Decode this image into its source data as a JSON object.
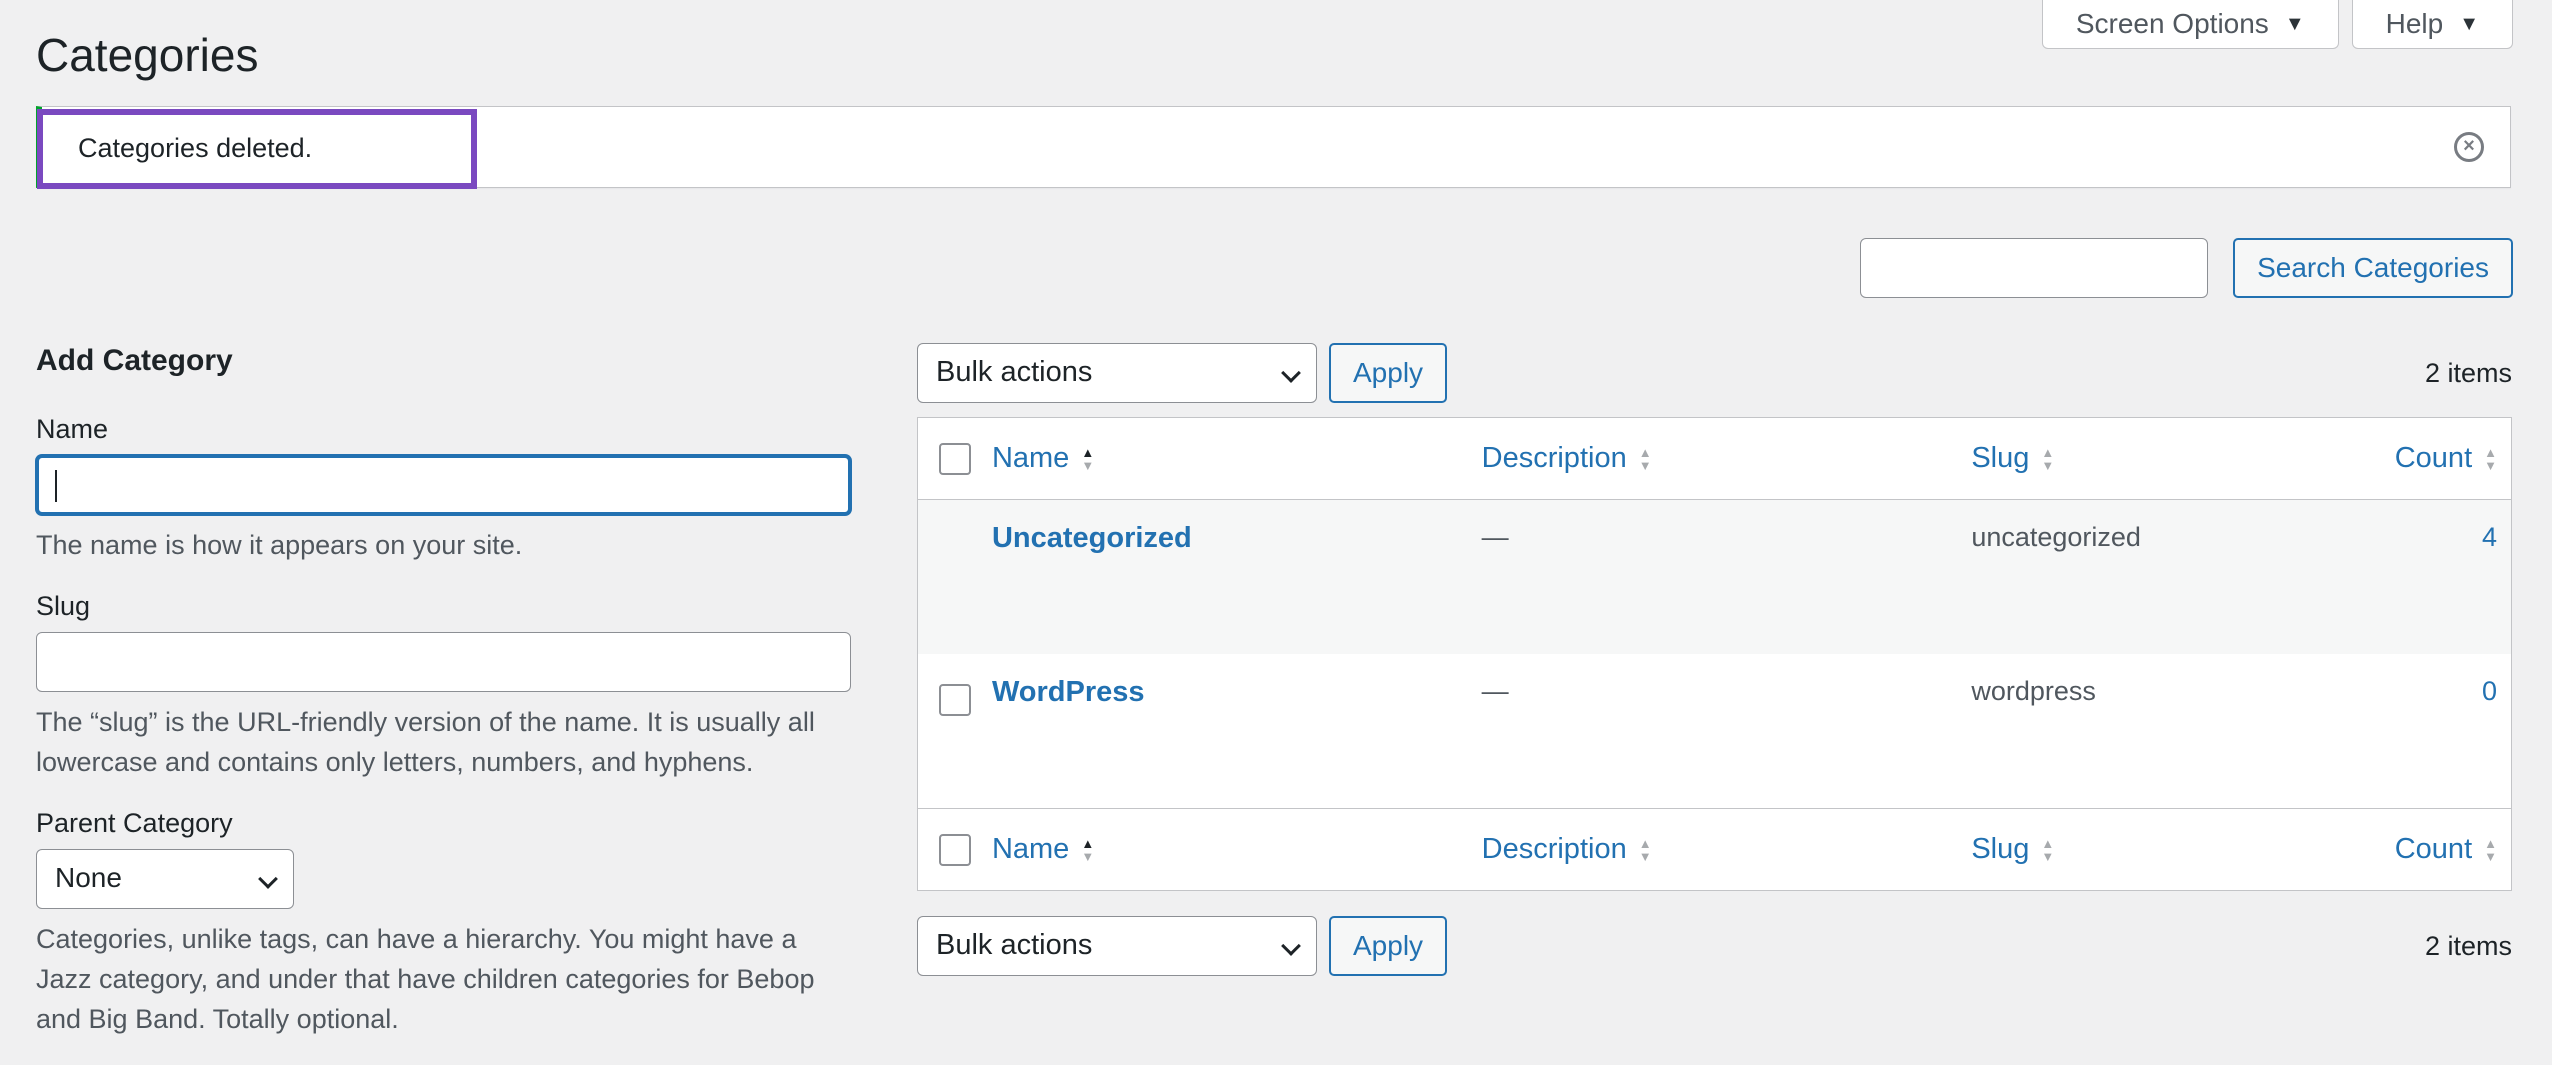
{
  "header": {
    "title": "Categories",
    "screen_options": "Screen Options",
    "help": "Help"
  },
  "notice": {
    "message": "Categories deleted."
  },
  "search": {
    "button": "Search Categories",
    "value": ""
  },
  "form": {
    "heading": "Add Category",
    "name_label": "Name",
    "name_help": "The name is how it appears on your site.",
    "slug_label": "Slug",
    "slug_help": "The “slug” is the URL-friendly version of the name. It is usually all lowercase and contains only letters, numbers, and hyphens.",
    "parent_label": "Parent Category",
    "parent_selected": "None",
    "parent_help": "Categories, unlike tags, can have a hierarchy. You might have a Jazz category, and under that have children categories for Bebop and Big Band. Totally optional."
  },
  "tablenav": {
    "bulk_selected": "Bulk actions",
    "apply": "Apply",
    "items": "2 items"
  },
  "table": {
    "columns": {
      "name": "Name",
      "description": "Description",
      "slug": "Slug",
      "count": "Count"
    },
    "rows": [
      {
        "name": "Uncategorized",
        "description": "—",
        "slug": "uncategorized",
        "count": "4"
      },
      {
        "name": "WordPress",
        "description": "—",
        "slug": "wordpress",
        "count": "0"
      }
    ]
  },
  "colors": {
    "accent": "#2271b1",
    "notice_border": "#00a32a",
    "highlight": "#7a49c0"
  }
}
